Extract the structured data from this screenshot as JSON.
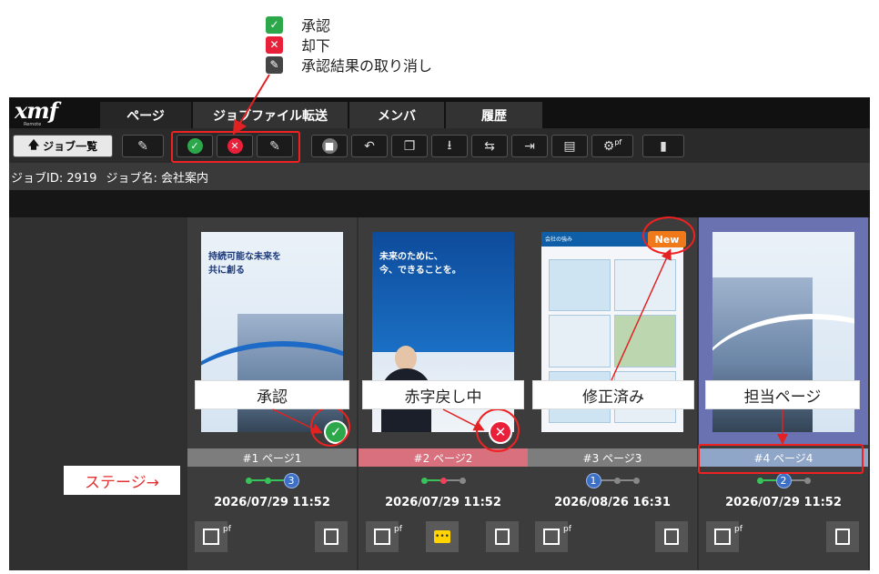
{
  "legend": [
    {
      "icon": "check-icon",
      "label": "承認"
    },
    {
      "icon": "x-icon",
      "label": "却下"
    },
    {
      "icon": "eraser-icon",
      "label": "承認結果の取り消し"
    }
  ],
  "logo": {
    "text": "xmf",
    "sub": "Remote"
  },
  "nav": {
    "tabs": [
      "ページ",
      "ジョブファイル転送",
      "メンバ",
      "履歴"
    ]
  },
  "toolbar": {
    "job_list": "ジョブ一覧",
    "pf_sup": "pf"
  },
  "job": {
    "id_label": "ジョブID: 2919",
    "name_label": "ジョブ名: 会社案内"
  },
  "pages": [
    {
      "title": "#1 ページ1",
      "date": "2026/07/29 11:52",
      "stage": "3",
      "status": "approved",
      "callout": "承認",
      "thumb_text": "持続可能な未来を\n共に創る"
    },
    {
      "title": "#2 ページ2",
      "date": "2026/07/29 11:52",
      "stage": "",
      "status": "rejected",
      "callout": "赤字戻し中",
      "thumb_text": "未来のために、\n今、できることを。"
    },
    {
      "title": "#3 ページ3",
      "date": "2026/08/26 16:31",
      "stage": "1",
      "status": "new",
      "callout": "修正済み",
      "thumb_text": "会社の強み"
    },
    {
      "title": "#4 ページ4",
      "date": "2026/07/29 11:52",
      "stage": "2",
      "status": "assigned",
      "callout": "担当ページ",
      "thumb_text": ""
    }
  ],
  "badges": {
    "new": "New",
    "pdf_sup": "pf"
  },
  "stage_label": "ステージ→",
  "colors": {
    "approve": "#2ca84b",
    "reject": "#e8203a",
    "annotation": "#e22222",
    "assigned": "#6a72b2"
  }
}
